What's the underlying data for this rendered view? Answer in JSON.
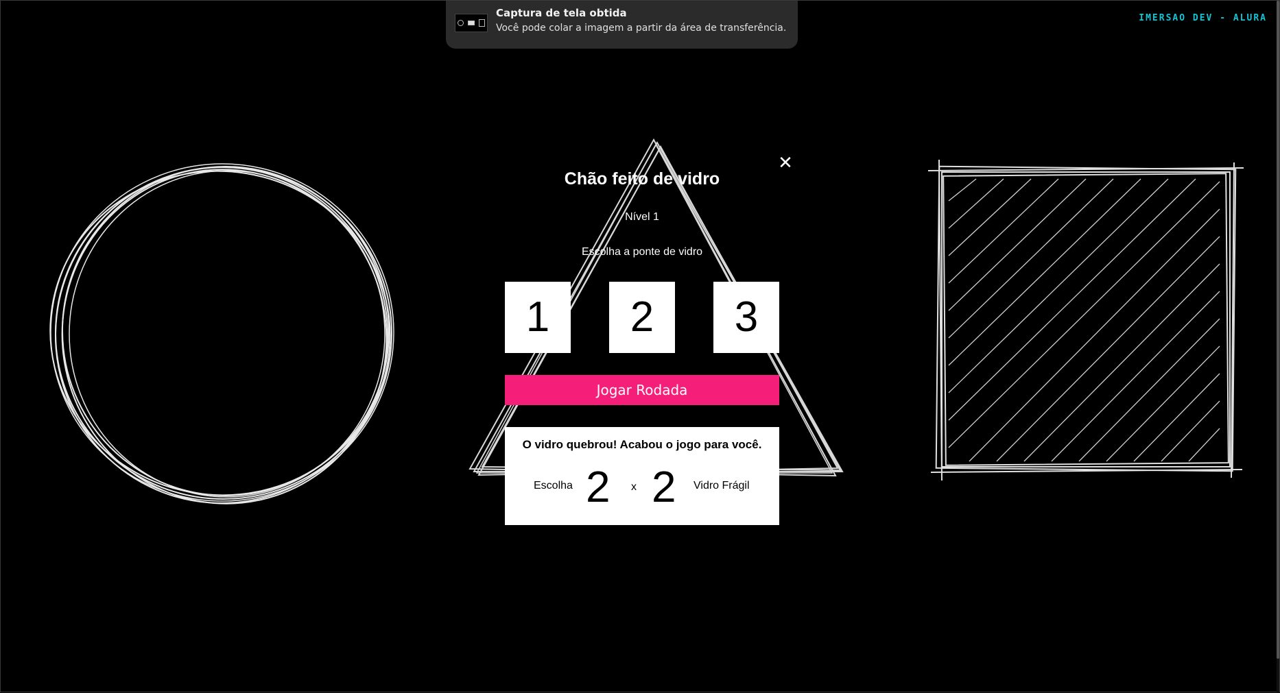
{
  "notification": {
    "title": "Captura de tela obtida",
    "body": "Você pode colar a imagem a partir da área de transferência."
  },
  "brand": {
    "text": "IMERSAO DEV - ALURA",
    "color": "#17c3d4"
  },
  "modal": {
    "close_icon": "✕",
    "title": "Chão feito de vidro",
    "level": "Nível 1",
    "instruction": "Escolha a ponte de vidro",
    "bridges": [
      "1",
      "2",
      "3"
    ],
    "play_button": "Jogar Rodada",
    "play_button_color": "#f51f7a"
  },
  "result": {
    "message": "O vidro quebrou! Acabou o jogo para você.",
    "choice_label": "Escolha",
    "choice_value": "2",
    "separator": "x",
    "fragile_value": "2",
    "fragile_label": "Vidro Frágil"
  },
  "background_shapes": [
    "circle-sketch",
    "triangle-sketch",
    "square-sketch"
  ]
}
